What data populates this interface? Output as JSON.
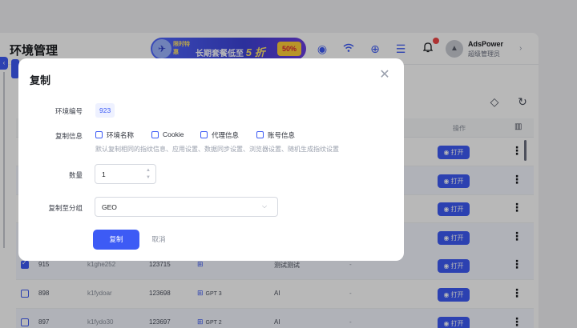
{
  "app": {
    "title": "环境管理",
    "collapse_icon": "chevron-left-icon",
    "promo": {
      "tag": "限时特惠",
      "text": "长期套餐低至",
      "highlight": "5 折",
      "badge": "50%"
    },
    "user": {
      "name": "AdsPower",
      "role": "超级管理员"
    }
  },
  "table": {
    "op_header": "操作",
    "open_label": "打开",
    "rows": [
      {
        "id": "",
        "serial": "",
        "account": "",
        "os": "",
        "os_label": "",
        "platform": "",
        "note": "",
        "checked": false
      },
      {
        "id": "",
        "serial": "",
        "account": "",
        "os": "",
        "os_label": "",
        "platform": "",
        "note": "",
        "checked": false
      },
      {
        "id": "",
        "serial": "",
        "account": "",
        "os": "",
        "os_label": "",
        "platform": "",
        "note": "",
        "checked": false
      },
      {
        "id": "",
        "serial": "",
        "account": "",
        "os": "",
        "os_label": "",
        "platform": "",
        "note": "",
        "checked": false
      },
      {
        "id": "915",
        "serial": "k1ghe252",
        "account": "123715",
        "os": "win",
        "os_label": "",
        "platform": "测试测试",
        "note": "-",
        "checked": true
      },
      {
        "id": "898",
        "serial": "k1fydoar",
        "account": "123698",
        "os": "win",
        "os_label": "GPT 3",
        "platform": "AI",
        "note": "-",
        "checked": false
      },
      {
        "id": "897",
        "serial": "k1fydo30",
        "account": "123697",
        "os": "win",
        "os_label": "GPT 2",
        "platform": "AI",
        "note": "-",
        "checked": false
      }
    ]
  },
  "modal": {
    "title": "复制",
    "env_no_label": "环境编号",
    "env_no": "923",
    "copy_info_label": "复制信息",
    "options": [
      "环境名称",
      "Cookie",
      "代理信息",
      "账号信息"
    ],
    "hint": "默认复制相同的指纹信息、应用设置、数据同步设置、浏览器设置、随机生成指纹设置",
    "quantity_label": "数量",
    "quantity": "1",
    "group_label": "复制至分组",
    "group_value": "GEO",
    "confirm": "复制",
    "cancel": "取消"
  },
  "colors": {
    "accent": "#3d5bf5",
    "danger": "#f04646"
  }
}
